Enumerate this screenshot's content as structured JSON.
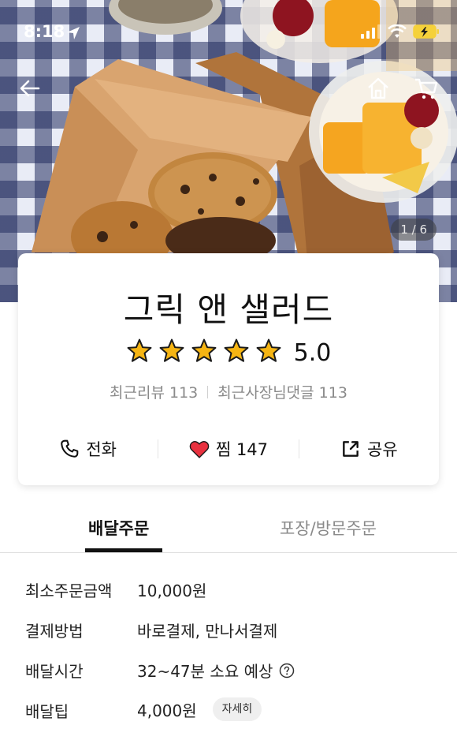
{
  "status_bar": {
    "time": "8:18"
  },
  "hero": {
    "photo_counter": "1 / 6"
  },
  "store": {
    "name": "그릭 앤 샐러드",
    "rating": "5.0",
    "rating_stars": 5,
    "recent_reviews": "최근리뷰 113",
    "recent_owner_replies": "최근사장님댓글 113"
  },
  "actions": {
    "call_label": "전화",
    "like_label": "찜 147",
    "share_label": "공유"
  },
  "tabs": [
    {
      "label": "배달주문",
      "active": true
    },
    {
      "label": "포장/방문주문",
      "active": false
    }
  ],
  "info": {
    "min_order": {
      "label": "최소주문금액",
      "value": "10,000원"
    },
    "payment": {
      "label": "결제방법",
      "value": "바로결제, 만나서결제"
    },
    "delivery_time": {
      "label": "배달시간",
      "value": "32~47분 소요 예상"
    },
    "delivery_tip": {
      "label": "배달팁",
      "value": "4,000원",
      "detail_label": "자세히"
    }
  },
  "colors": {
    "star": "#f6b513",
    "heart": "#e8313f",
    "tab_active": "#111111",
    "text_muted": "#8a8a8a"
  }
}
